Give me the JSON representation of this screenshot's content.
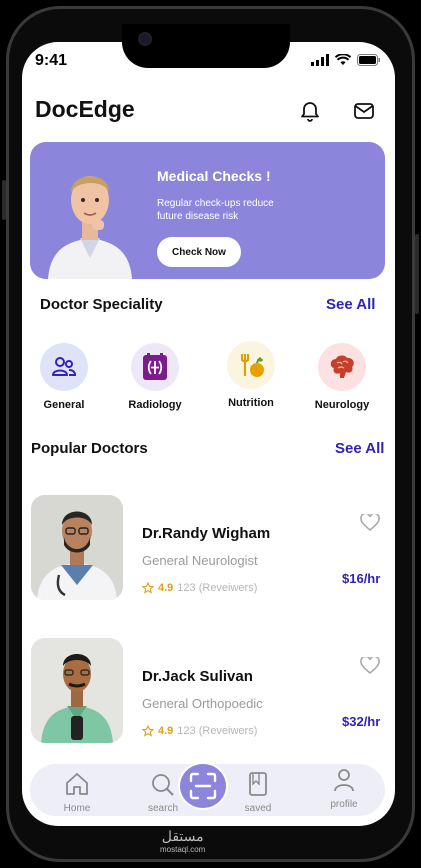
{
  "status": {
    "time": "9:41"
  },
  "app": {
    "title": "DocEdge"
  },
  "banner": {
    "title": "Medical Checks !",
    "subtitle": "Regular check-ups reduce future disease risk",
    "button": "Check Now"
  },
  "speciality": {
    "title": "Doctor Speciality",
    "see_all": "See All",
    "items": [
      {
        "label": "General",
        "icon": "people-icon",
        "bg": "#dfe3fa"
      },
      {
        "label": "Radiology",
        "icon": "radiology-icon",
        "bg": "#efe7f7"
      },
      {
        "label": "Nutrition",
        "icon": "nutrition-icon",
        "bg": "#fbf4df"
      },
      {
        "label": "Neurology",
        "icon": "brain-icon",
        "bg": "#fbe1e1"
      }
    ]
  },
  "popular": {
    "title": "Popular Doctors",
    "see_all": "See All",
    "doctors": [
      {
        "name": "Dr.Randy Wigham",
        "specialty": "General Neurologist",
        "rating": "4.9",
        "reviewers": "123 (Reveiwers)",
        "price": "$16/hr"
      },
      {
        "name": "Dr.Jack Sulivan",
        "specialty": "General Orthopoedic",
        "rating": "4.9",
        "reviewers": "123 (Reveiwers)",
        "price": "$32/hr"
      }
    ]
  },
  "nav": {
    "home": "Home",
    "search": "search",
    "saved": "saved",
    "profile": "profile"
  },
  "watermark": {
    "arabic": "مستقل",
    "latin": "mostaql.com"
  },
  "colors": {
    "accent": "#8b86dc",
    "link": "#2f23b8",
    "star": "#e0a020"
  }
}
